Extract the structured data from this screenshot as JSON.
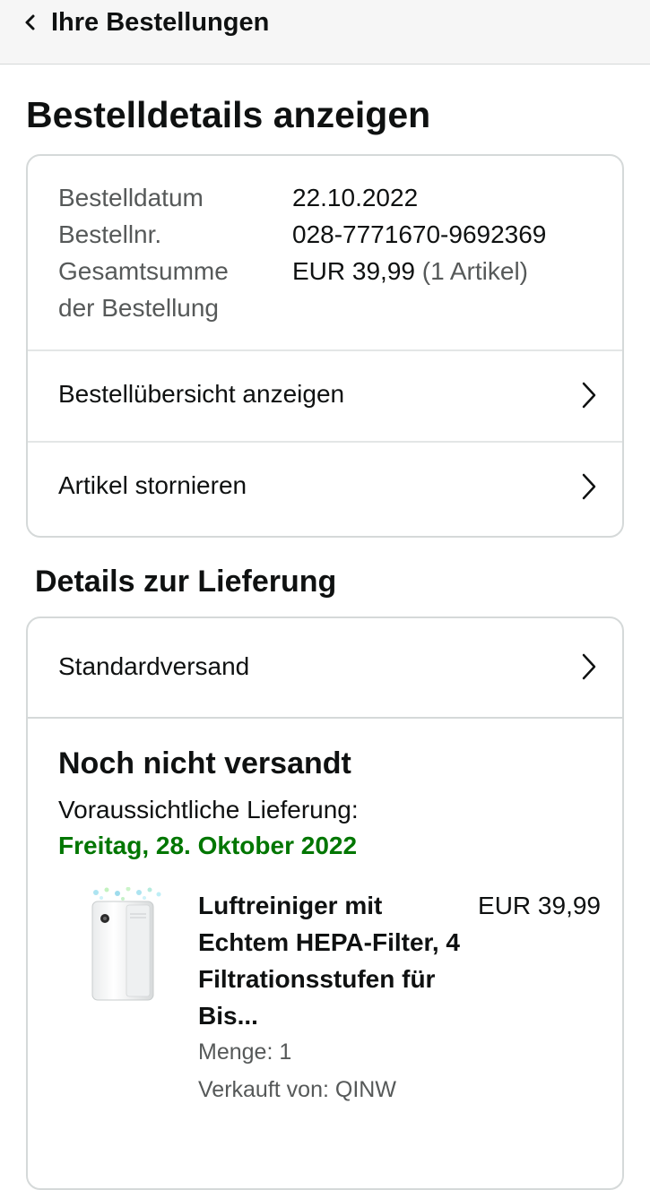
{
  "header": {
    "back_label": "Ihre Bestellungen"
  },
  "page": {
    "title": "Bestelldetails anzeigen"
  },
  "summary": {
    "order_date_label": "Bestelldatum",
    "order_date": "22.10.2022",
    "order_number_label": "Bestellnr.",
    "order_number": "028-7771670-9692369",
    "total_label_line1": "Gesamtsumme",
    "total_label_line2": "der Bestellung",
    "total_amount": "EUR 39,99",
    "total_items": "(1 Artikel)",
    "links": [
      {
        "label": "Bestellübersicht anzeigen"
      },
      {
        "label": "Artikel stornieren"
      }
    ]
  },
  "delivery": {
    "section_title": "Details zur Lieferung",
    "shipping_method": "Standardversand",
    "status": "Noch nicht versandt",
    "eta_label": "Voraussichtliche Lieferung:",
    "eta_date": "Freitag, 28. Oktober 2022",
    "item": {
      "title": "Luftreiniger mit Echtem HEPA-Filter, 4 Filtrationsstufen für Bis...",
      "price": "EUR 39,99",
      "quantity": "Menge: 1",
      "seller": "Verkauft von: QINW",
      "image_icon": "air-purifier-product-image"
    }
  },
  "colors": {
    "topbar_bg": "#f6f6f6",
    "delivery_date": "#007600",
    "muted_text": "#565959",
    "border": "#d5d9d9"
  }
}
